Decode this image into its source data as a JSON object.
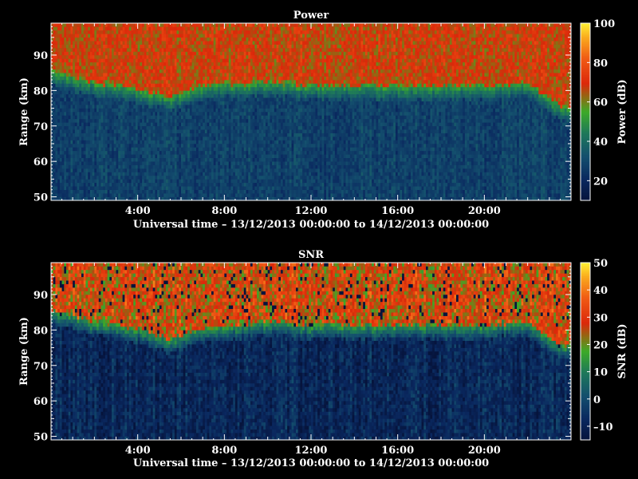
{
  "chart_data": [
    {
      "type": "heatmap",
      "title": "Power",
      "xlabel": "Universal time – 13/12/2013 00:00:00 to 14/12/2013 00:00:00",
      "ylabel": "Range (km)",
      "xlim": [
        0,
        24
      ],
      "ylim": [
        49,
        99
      ],
      "xticks": [
        {
          "v": 4,
          "label": "4:00"
        },
        {
          "v": 8,
          "label": "8:00"
        },
        {
          "v": 12,
          "label": "12:00"
        },
        {
          "v": 16,
          "label": "16:00"
        },
        {
          "v": 20,
          "label": "20:00"
        }
      ],
      "yticks": [
        {
          "v": 50,
          "label": "50"
        },
        {
          "v": 60,
          "label": "60"
        },
        {
          "v": 70,
          "label": "70"
        },
        {
          "v": 80,
          "label": "80"
        },
        {
          "v": 90,
          "label": "90"
        }
      ],
      "colorbar": {
        "label": "Power (dB)",
        "range": [
          10,
          100
        ],
        "ticks": [
          {
            "v": 20,
            "label": "20"
          },
          {
            "v": 40,
            "label": "40"
          },
          {
            "v": 60,
            "label": "60"
          },
          {
            "v": 80,
            "label": "80"
          },
          {
            "v": 100,
            "label": "100"
          }
        ]
      },
      "echo_boundary_km": [
        [
          0,
          85
        ],
        [
          2,
          82
        ],
        [
          4,
          80
        ],
        [
          5.5,
          78
        ],
        [
          7,
          81
        ],
        [
          10,
          82
        ],
        [
          12,
          81
        ],
        [
          14,
          81
        ],
        [
          16,
          81
        ],
        [
          18,
          81
        ],
        [
          20,
          81
        ],
        [
          22,
          82
        ],
        [
          23.5,
          75
        ]
      ],
      "echo_top_value": 68,
      "background_value": 28
    },
    {
      "type": "heatmap",
      "title": "SNR",
      "xlabel": "Universal time – 13/12/2013 00:00:00 to 14/12/2013 00:00:00",
      "ylabel": "Range (km)",
      "xlim": [
        0,
        24
      ],
      "ylim": [
        49,
        99
      ],
      "xticks": [
        {
          "v": 4,
          "label": "4:00"
        },
        {
          "v": 8,
          "label": "8:00"
        },
        {
          "v": 12,
          "label": "12:00"
        },
        {
          "v": 16,
          "label": "16:00"
        },
        {
          "v": 20,
          "label": "20:00"
        }
      ],
      "yticks": [
        {
          "v": 50,
          "label": "50"
        },
        {
          "v": 60,
          "label": "60"
        },
        {
          "v": 70,
          "label": "70"
        },
        {
          "v": 80,
          "label": "80"
        },
        {
          "v": 90,
          "label": "90"
        }
      ],
      "colorbar": {
        "label": "SNR (dB)",
        "range": [
          -15,
          50
        ],
        "ticks": [
          {
            "v": -10,
            "label": "–10"
          },
          {
            "v": 0,
            "label": "0"
          },
          {
            "v": 10,
            "label": "10"
          },
          {
            "v": 20,
            "label": "20"
          },
          {
            "v": 30,
            "label": "30"
          },
          {
            "v": 40,
            "label": "40"
          },
          {
            "v": 50,
            "label": "50"
          }
        ]
      },
      "echo_boundary_km": [
        [
          0,
          85
        ],
        [
          2,
          82
        ],
        [
          4,
          80
        ],
        [
          5.5,
          77
        ],
        [
          7,
          80
        ],
        [
          10,
          82
        ],
        [
          12,
          81
        ],
        [
          14,
          81
        ],
        [
          16,
          81
        ],
        [
          18,
          81
        ],
        [
          20,
          81
        ],
        [
          22,
          82
        ],
        [
          23.5,
          75
        ]
      ],
      "echo_top_value": 28,
      "background_value": -8
    }
  ]
}
